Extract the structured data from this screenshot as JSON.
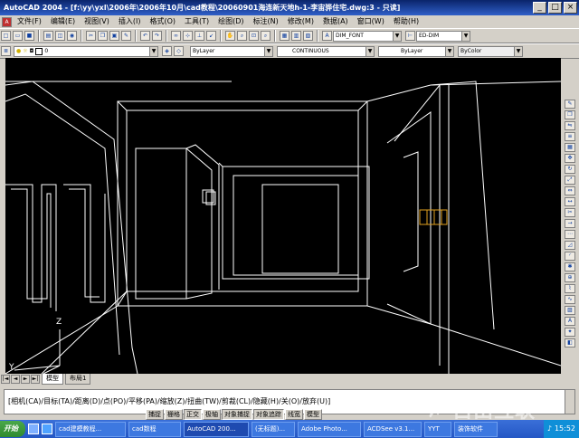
{
  "window": {
    "title": "AutoCAD 2004 - [f:\\yy\\yxl\\2006年\\2006年10月\\cad教程\\20060901海连新天地h-1-李宙骅住宅.dwg:3 - 只读]",
    "btn_min": "_",
    "btn_max": "□",
    "btn_close": "×"
  },
  "menu": [
    "文件(F)",
    "编辑(E)",
    "视图(V)",
    "插入(I)",
    "格式(O)",
    "工具(T)",
    "绘图(D)",
    "标注(N)",
    "修改(M)",
    "数据(A)",
    "窗口(W)",
    "帮助(H)"
  ],
  "toolbar1": {
    "text_style": "DIM_FONT",
    "dim_style": "ED-DIM"
  },
  "toolbar2": {
    "layer": "0",
    "color": "ByLayer",
    "linetype": "CONTINUOUS",
    "lineweight": "ByLayer",
    "plotstyle": "ByColor"
  },
  "viewport": {
    "ucs_z": "Z",
    "ucs_y": "Y",
    "accent_color": "#e0a020"
  },
  "tabs": {
    "nav": [
      "|◄",
      "◄",
      "►",
      "►|"
    ],
    "model": "模型",
    "layout": "布局1"
  },
  "command_line": "[相机(CA)/目标(TA)/距离(D)/点(PO)/平移(PA)/缩放(Z)/扭曲(TW)/剪裁(CL)/隐藏(H)/关(O)/放弃(U)]",
  "status": [
    "捕捉",
    "栅格",
    "正交",
    "极轴",
    "对象捕捉",
    "对象追踪",
    "线宽",
    "模型"
  ],
  "status_on": [
    false,
    false,
    true,
    false,
    true,
    true,
    false,
    false
  ],
  "taskbar": {
    "start": "开始",
    "tasks": [
      "cad建模教程...",
      "cad数程",
      "AutoCAD 200...",
      "(无标题)...",
      "Adobe Photo...",
      "ACDSee v3.1...",
      "YYT",
      "装饰软件"
    ],
    "active_index": 2,
    "clock": "15:52"
  },
  "watermark": "✗ 自由互联"
}
